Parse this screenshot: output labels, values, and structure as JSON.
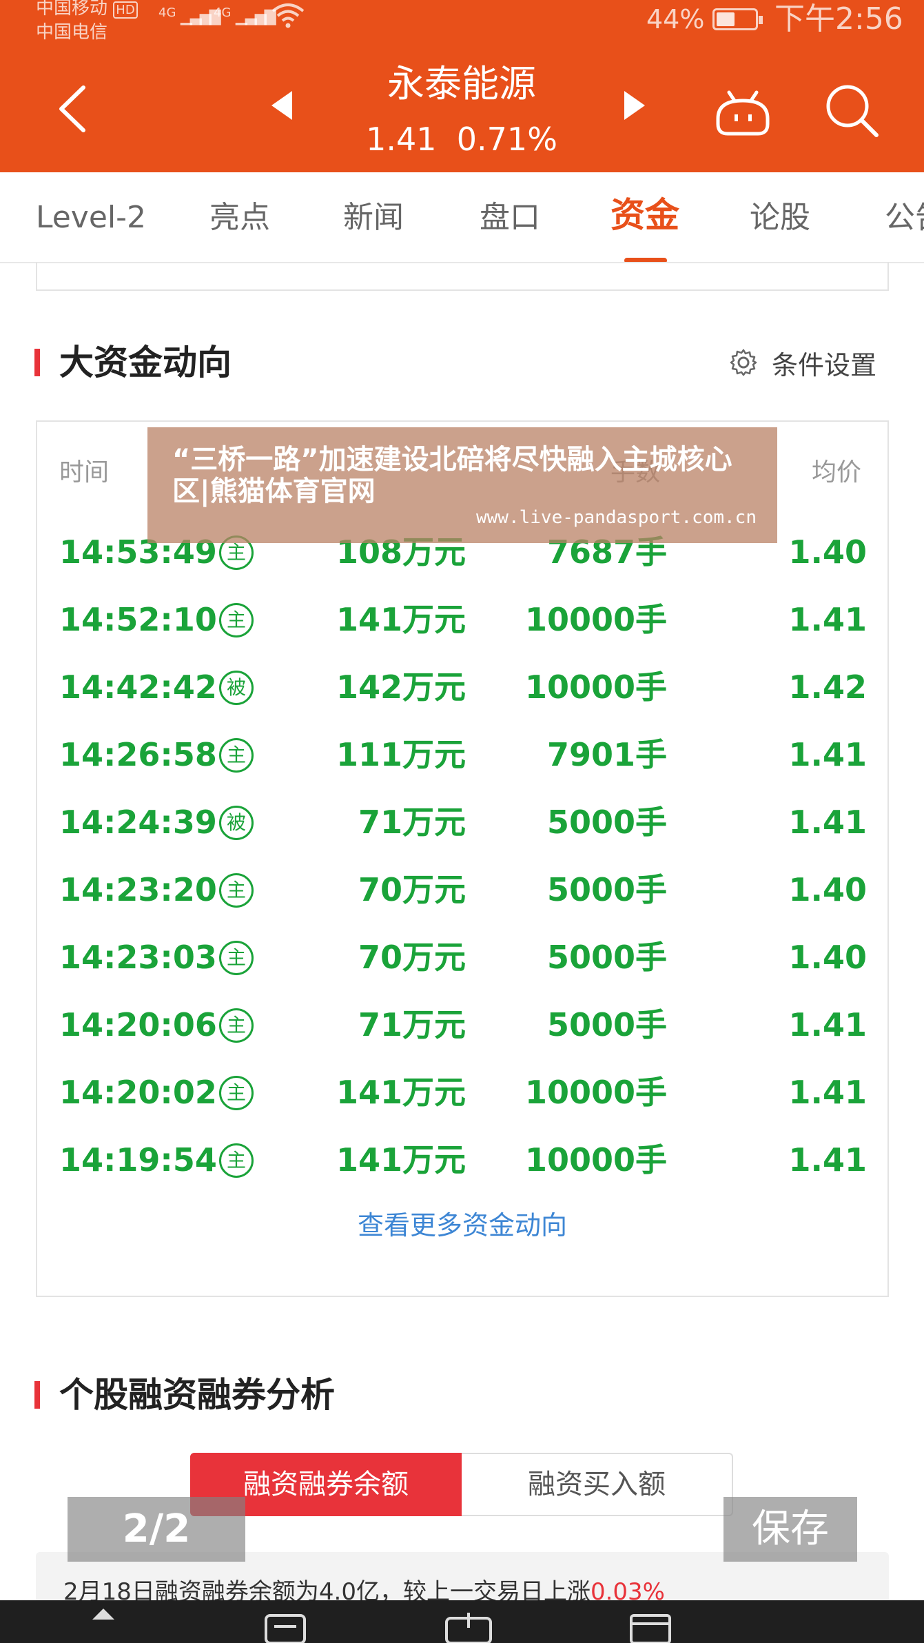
{
  "status_bar": {
    "carrier_1": "中国移动",
    "carrier_1_badge": "HD",
    "carrier_2": "中国电信",
    "signal_1": "4G",
    "signal_2": "4G",
    "battery": "44%",
    "battery_level": 0.44,
    "time": "下午2:56"
  },
  "header": {
    "stock_name": "永泰能源",
    "price": "1.41",
    "change": "0.71%",
    "icons": [
      "back-icon",
      "prev-icon",
      "next-icon",
      "robot-icon",
      "search-icon"
    ]
  },
  "tabs": [
    {
      "label": "Level-2",
      "active": false
    },
    {
      "label": "亮点",
      "active": false
    },
    {
      "label": "新闻",
      "active": false
    },
    {
      "label": "盘口",
      "active": false
    },
    {
      "label": "资金",
      "active": true
    },
    {
      "label": "论股",
      "active": false
    },
    {
      "label": "公告",
      "active": false
    }
  ],
  "big_money": {
    "title": "大资金动向",
    "settings_label": "条件设置",
    "headers": {
      "time": "时间",
      "volume": "手数",
      "avg_price": "均价"
    },
    "rows": [
      {
        "time": "14:53:49",
        "type": "主",
        "amount": "108万元",
        "volume": "7687手",
        "avg": "1.40"
      },
      {
        "time": "14:52:10",
        "type": "主",
        "amount": "141万元",
        "volume": "10000手",
        "avg": "1.41"
      },
      {
        "time": "14:42:42",
        "type": "被",
        "amount": "142万元",
        "volume": "10000手",
        "avg": "1.42"
      },
      {
        "time": "14:26:58",
        "type": "主",
        "amount": "111万元",
        "volume": "7901手",
        "avg": "1.41"
      },
      {
        "time": "14:24:39",
        "type": "被",
        "amount": "71万元",
        "volume": "5000手",
        "avg": "1.41"
      },
      {
        "time": "14:23:20",
        "type": "主",
        "amount": "70万元",
        "volume": "5000手",
        "avg": "1.40"
      },
      {
        "time": "14:23:03",
        "type": "主",
        "amount": "70万元",
        "volume": "5000手",
        "avg": "1.40"
      },
      {
        "time": "14:20:06",
        "type": "主",
        "amount": "71万元",
        "volume": "5000手",
        "avg": "1.41"
      },
      {
        "time": "14:20:02",
        "type": "主",
        "amount": "141万元",
        "volume": "10000手",
        "avg": "1.41"
      },
      {
        "time": "14:19:54",
        "type": "主",
        "amount": "141万元",
        "volume": "10000手",
        "avg": "1.41"
      }
    ],
    "more_link": "查看更多资金动向"
  },
  "watermark": {
    "title": "“三桥一路”加速建设北碚将尽快融入主城核心区|熊猫体育官网",
    "url": "www.live-pandasport.com.cn"
  },
  "margin": {
    "title": "个股融资融券分析",
    "tab_active": "融资融券余额",
    "tab_inactive": "融资买入额",
    "summary_prefix": "2月18日融资融券余额为4.0亿，较上一交易日上涨",
    "summary_change": "0.03%"
  },
  "overlay": {
    "page_indicator": "2/2",
    "save_label": "保存"
  },
  "colors": {
    "brand": "#e8501a",
    "up_red": "#e8333a",
    "flow_green": "#1aa339",
    "link_blue": "#3d86d4"
  }
}
